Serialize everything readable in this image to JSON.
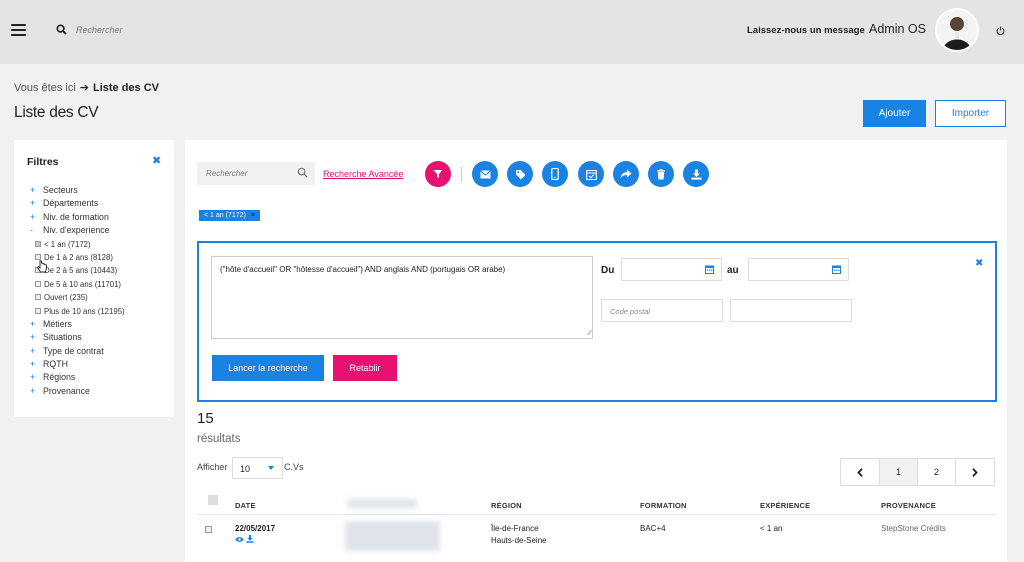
{
  "header": {
    "search_placeholder": "Rechercher",
    "message_link": "Laissez-nous un message",
    "user_name": "Admin OS"
  },
  "breadcrumb": {
    "here": "Vous êtes ici",
    "current": "Liste des CV"
  },
  "page": {
    "title": "Liste des CV",
    "add_label": "Ajouter",
    "import_label": "Importer"
  },
  "filters": {
    "title": "Filtres",
    "items": [
      {
        "label": "Secteurs"
      },
      {
        "label": "Départements"
      },
      {
        "label": "Niv. de formation"
      },
      {
        "label": "Niv. d'experience"
      }
    ],
    "experience_options": [
      {
        "label": "< 1 an (7172)",
        "checked": true
      },
      {
        "label": "De 1 à 2 ans (8128)",
        "checked": false
      },
      {
        "label": "De 2 à 5 ans (10443)",
        "checked": false
      },
      {
        "label": "De 5 à 10 ans (11701)",
        "checked": false
      },
      {
        "label": "Ouvert (235)",
        "checked": false
      },
      {
        "label": "Plus de 10 ans (12195)",
        "checked": false
      }
    ],
    "items_after": [
      {
        "label": "Métiers"
      },
      {
        "label": "Situations"
      },
      {
        "label": "Type de contrat"
      },
      {
        "label": "RQTH"
      },
      {
        "label": "Régions"
      },
      {
        "label": "Provenance"
      }
    ]
  },
  "toolbar": {
    "search_placeholder": "Rechercher",
    "advanced_search": "Recherche Avancée",
    "icons": [
      "filter-icon",
      "email-icon",
      "tag-icon",
      "mobile-icon",
      "calendar-icon",
      "share-icon",
      "trash-icon",
      "download-icon"
    ]
  },
  "active_tag": {
    "label": "< 1 an (7172)"
  },
  "advanced": {
    "query": "(\"hôte d'accueil\" OR \"hôtesse d'accueil\") AND anglais AND (portugais OR arabe)",
    "du_label": "Du",
    "au_label": "au",
    "du_value": "",
    "au_value": "",
    "postal_placeholder": "Code postal",
    "launch_label": "Lancer la recherche",
    "reset_label": "Retablir"
  },
  "results": {
    "count": "15",
    "label": "résultats",
    "show_label": "Afficher",
    "per_page": "10",
    "per_page_suffix": "C.Vs"
  },
  "pagination": {
    "pages": [
      "1",
      "2"
    ],
    "current": "1"
  },
  "table": {
    "columns": [
      "DATE",
      "RÉGION",
      "FORMATION",
      "EXPÉRIENCE",
      "PROVENANCE"
    ],
    "rows": [
      {
        "date": "22/05/2017",
        "region_line1": "Île-de-France",
        "region_line2": "Hauts-de-Seine",
        "formation": "BAC+4",
        "experience": "< 1 an",
        "provenance": "StepStone Crédits"
      }
    ]
  },
  "colors": {
    "primary": "#1a82e2",
    "accent": "#e8116f"
  }
}
